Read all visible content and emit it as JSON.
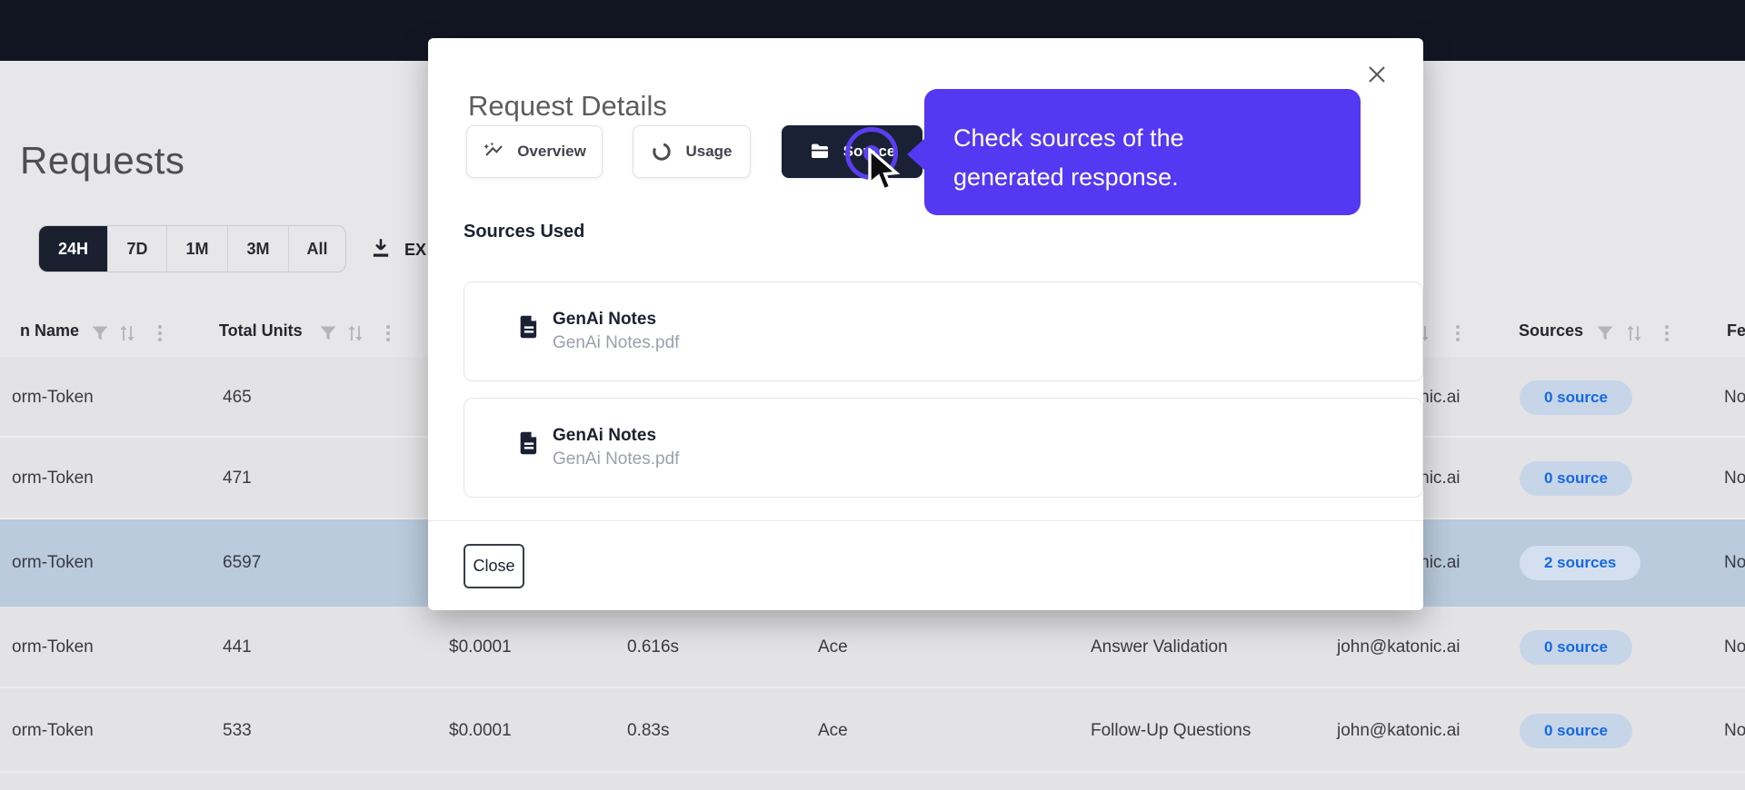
{
  "colors": {
    "accent_purple": "#5538f2",
    "topbar": "#121623",
    "selected_row": "#b9cbdd",
    "pill_bg": "#c7d5e9",
    "pill_bg_selected": "#d4e0f0",
    "pill_text": "#1668e3",
    "active_tab_bg": "#1b2134"
  },
  "page": {
    "title": "Requests",
    "time_filters": [
      "24H",
      "7D",
      "1M",
      "3M",
      "All"
    ],
    "selected_filter": "24H",
    "export_label": "EX"
  },
  "table": {
    "headers": [
      {
        "label": "n Name",
        "icons": [
          "filter",
          "sort",
          "menu"
        ]
      },
      {
        "label": "Total Units",
        "icons": [
          "filter",
          "sort",
          "menu"
        ]
      },
      {
        "label": "",
        "icons": [
          "filter",
          "sort",
          "menu"
        ]
      },
      {
        "label": "Sources",
        "icons": [
          "filter",
          "sort",
          "menu"
        ]
      },
      {
        "label": "Fe",
        "icons": []
      }
    ],
    "rows": [
      {
        "token_name": "orm-Token",
        "total_units": "465",
        "cost": "",
        "latency": "",
        "model": "",
        "app": "",
        "user": "john@katonic.ai",
        "sources": "0 source",
        "feedback": "No",
        "selected": false
      },
      {
        "token_name": "orm-Token",
        "total_units": "471",
        "cost": "",
        "latency": "",
        "model": "",
        "app": "",
        "user": "john@katonic.ai",
        "sources": "0 source",
        "feedback": "No",
        "selected": false
      },
      {
        "token_name": "orm-Token",
        "total_units": "6597",
        "cost": "",
        "latency": "",
        "model": "",
        "app": "",
        "user": "john@katonic.ai",
        "sources": "2 sources",
        "feedback": "No",
        "selected": true
      },
      {
        "token_name": "orm-Token",
        "total_units": "441",
        "cost": "$0.0001",
        "latency": "0.616s",
        "model": "Ace",
        "app": "Answer Validation",
        "user": "john@katonic.ai",
        "sources": "0 source",
        "feedback": "No",
        "selected": false
      },
      {
        "token_name": "orm-Token",
        "total_units": "533",
        "cost": "$0.0001",
        "latency": "0.83s",
        "model": "Ace",
        "app": "Follow-Up Questions",
        "user": "john@katonic.ai",
        "sources": "0 source",
        "feedback": "No",
        "selected": false
      }
    ]
  },
  "modal": {
    "title": "Request Details",
    "close_icon": "✕",
    "tabs": [
      {
        "label": "Overview",
        "icon": "auto-graph-icon",
        "active": false
      },
      {
        "label": "Usage",
        "icon": "data-usage-icon",
        "active": false
      },
      {
        "label": "Source",
        "icon": "folder-icon",
        "active": true
      }
    ],
    "sources_heading": "Sources Used",
    "sources": [
      {
        "title": "GenAi Notes",
        "filename": "GenAi Notes.pdf"
      },
      {
        "title": "GenAi Notes",
        "filename": "GenAi Notes.pdf"
      }
    ],
    "close_label": "Close"
  },
  "tooltip": {
    "lines": [
      "Check sources of the",
      "generated response."
    ]
  }
}
